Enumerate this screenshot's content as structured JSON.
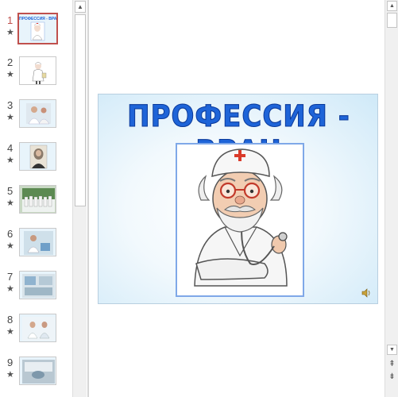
{
  "thumbnails": [
    {
      "number": "1",
      "star": "★",
      "active": true
    },
    {
      "number": "2",
      "star": "★"
    },
    {
      "number": "3",
      "star": "★"
    },
    {
      "number": "4",
      "star": "★"
    },
    {
      "number": "5",
      "star": "★"
    },
    {
      "number": "6",
      "star": "★"
    },
    {
      "number": "7",
      "star": "★"
    },
    {
      "number": "8",
      "star": "★"
    },
    {
      "number": "9",
      "star": "★"
    }
  ],
  "slide": {
    "title": "ПРОФЕССИЯ - ВРАЧ",
    "thumb_title": "ПРОФЕССИЯ - ВРАЧ"
  },
  "icons": {
    "scroll_up": "▲",
    "scroll_down": "▼",
    "prev_slide": "⇞",
    "next_slide": "⇟",
    "speaker": "speaker-icon"
  },
  "colors": {
    "accent_active": "#c0504d",
    "title_blue": "#1e64d8"
  }
}
